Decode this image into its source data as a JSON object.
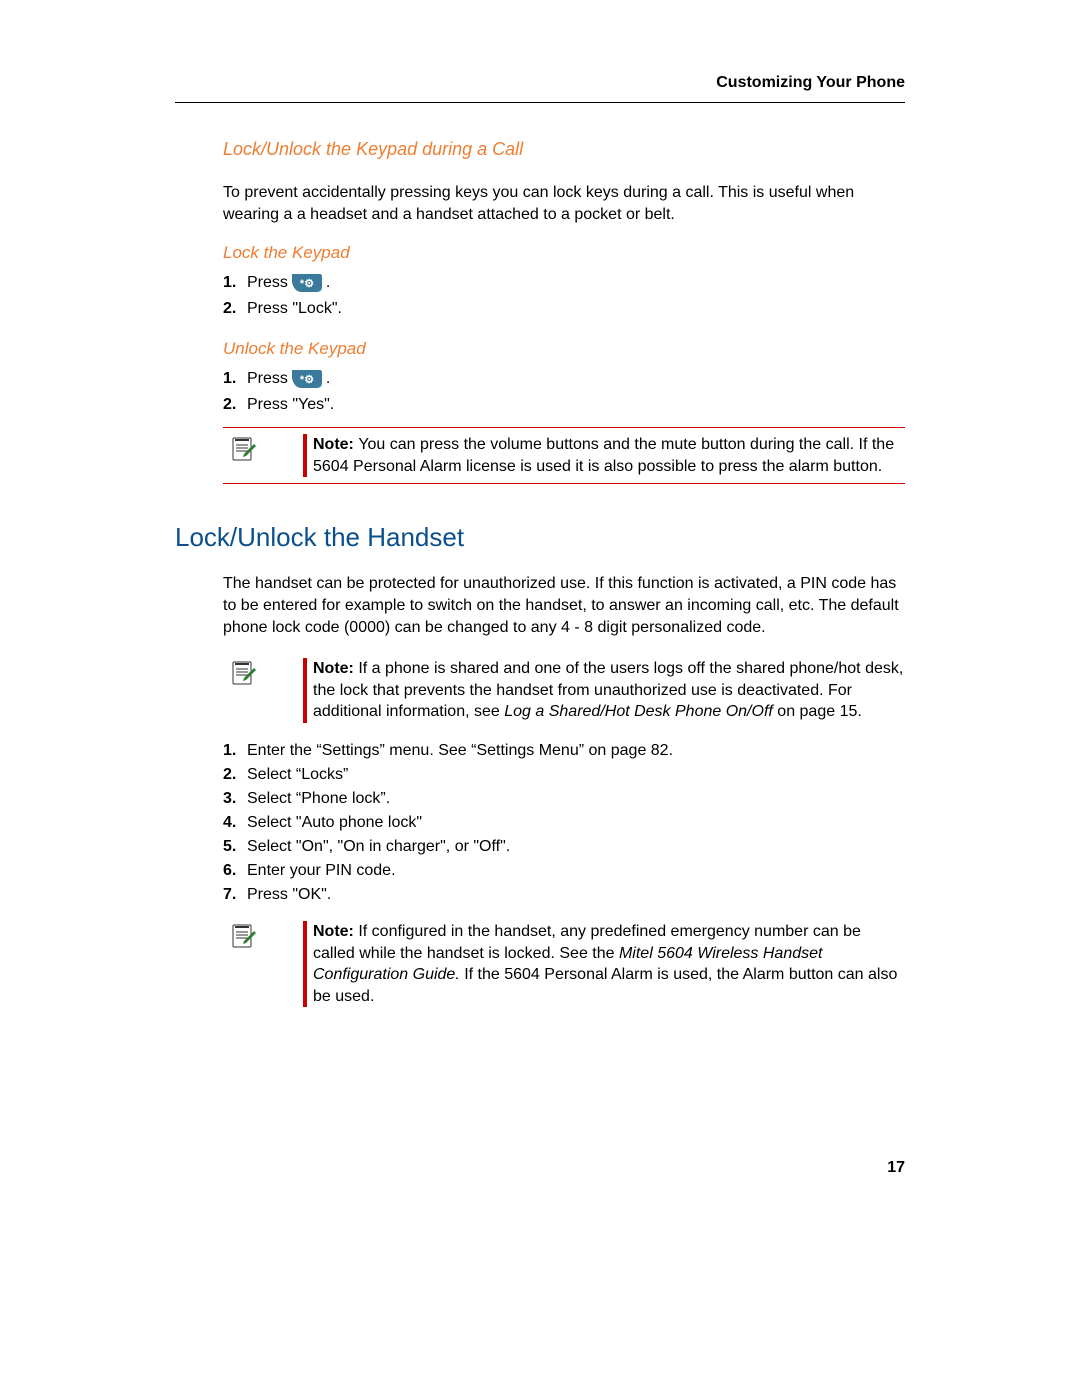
{
  "header": {
    "running": "Customizing Your Phone"
  },
  "s1": {
    "title": "Lock/Unlock the Keypad during a Call",
    "intro": "To prevent accidentally pressing keys you can lock keys during a call. This is useful when wearing a a headset and a handset attached to a pocket or belt.",
    "lock": {
      "title": "Lock the Keypad",
      "steps": {
        "n1": "1.",
        "t1a": "Press ",
        "t1b": ".",
        "n2": "2.",
        "t2": "Press \"Lock\"."
      }
    },
    "unlock": {
      "title": "Unlock the Keypad",
      "steps": {
        "n1": "1.",
        "t1a": "Press ",
        "t1b": ".",
        "n2": "2.",
        "t2": "Press \"Yes\"."
      }
    },
    "note": {
      "lead": "Note: ",
      "body": "You can press the volume buttons and the mute button during the call. If the 5604 Personal Alarm license is used it is also possible to press the alarm button."
    }
  },
  "s2": {
    "title": "Lock/Unlock the Handset",
    "intro": "The handset can be protected for unauthorized use. If this function is activated, a PIN code has to be entered for example to switch on the handset, to answer an incoming call, etc. The default phone lock code (0000) can be changed to any 4 - 8 digit personalized code.",
    "note1": {
      "lead": "Note: ",
      "body_a": "If a phone is shared and one of the users logs off the shared phone/hot desk, the lock that prevents the handset from unauthorized use is deactivated. For additional information, see ",
      "body_it": "Log a Shared/Hot Desk Phone On/Off",
      "body_b": " on page 15."
    },
    "steps": {
      "n1": "1.",
      "t1": "Enter the “Settings” menu. See “Settings Menu” on page 82.",
      "n2": "2.",
      "t2": "Select “Locks”",
      "n3": "3.",
      "t3": "Select “Phone lock”.",
      "n4": "4.",
      "t4": "Select \"Auto phone lock\"",
      "n5": "5.",
      "t5": "Select \"On\", \"On in charger\", or \"Off\".",
      "n6": "6.",
      "t6": "Enter your PIN code.",
      "n7": "7.",
      "t7": "Press \"OK\"."
    },
    "note2": {
      "lead": "Note: ",
      "body_a": "If configured in the handset, any predefined emergency number can be called while the handset is locked. See the ",
      "body_it": "Mitel 5604 Wireless Handset Configuration Guide.",
      "body_b": " If the 5604 Personal Alarm is used, the Alarm button can also be used."
    }
  },
  "page_number": "17"
}
